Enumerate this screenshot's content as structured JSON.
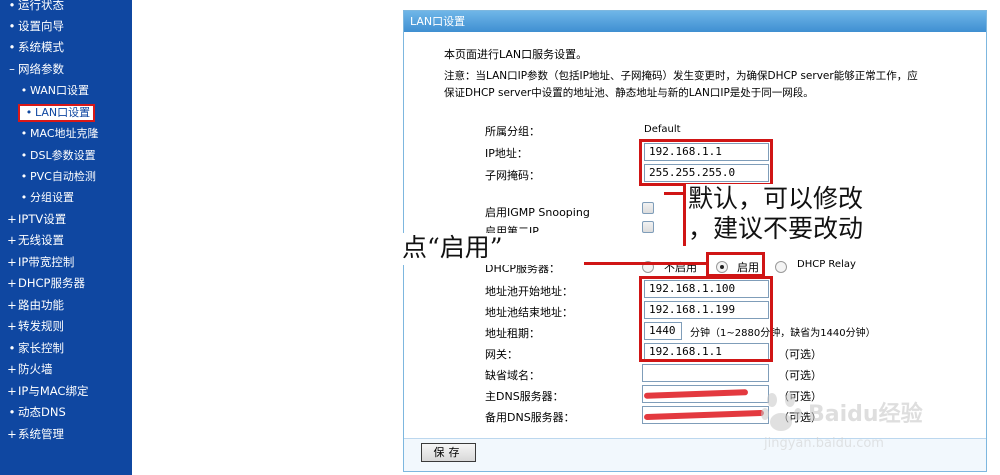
{
  "sidebar": {
    "items": [
      {
        "label": "运行状态",
        "mark": "•"
      },
      {
        "label": "设置向导",
        "mark": "•"
      },
      {
        "label": "系统模式",
        "mark": "•"
      },
      {
        "label": "网络参数",
        "mark": "–"
      },
      {
        "label": "WAN口设置",
        "mark": "•"
      },
      {
        "label": "LAN口设置",
        "mark": "•"
      },
      {
        "label": "MAC地址克隆",
        "mark": "•"
      },
      {
        "label": "DSL参数设置",
        "mark": "•"
      },
      {
        "label": "PVC自动检测",
        "mark": "•"
      },
      {
        "label": "分组设置",
        "mark": "•"
      },
      {
        "label": "IPTV设置",
        "mark": "+"
      },
      {
        "label": "无线设置",
        "mark": "+"
      },
      {
        "label": "IP带宽控制",
        "mark": "+"
      },
      {
        "label": "DHCP服务器",
        "mark": "+"
      },
      {
        "label": "路由功能",
        "mark": "+"
      },
      {
        "label": "转发规则",
        "mark": "+"
      },
      {
        "label": "家长控制",
        "mark": "•"
      },
      {
        "label": "防火墙",
        "mark": "+"
      },
      {
        "label": "IP与MAC绑定",
        "mark": "+"
      },
      {
        "label": "动态DNS",
        "mark": "•"
      },
      {
        "label": "系统管理",
        "mark": "+"
      }
    ]
  },
  "panel": {
    "title": "LAN口设置",
    "intro": "本页面进行LAN口服务设置。",
    "note_line1": "注意：当LAN口IP参数（包括IP地址、子网掩码）发生变更时，为确保DHCP server能够正常工作，应",
    "note_line2": "保证DHCP server中设置的地址池、静态地址与新的LAN口IP是处于同一网段。"
  },
  "form": {
    "group_label": "所属分组：",
    "group_value": "Default",
    "ip_label": "IP地址：",
    "ip_value": "192.168.1.1",
    "mask_label": "子网掩码：",
    "mask_value": "255.255.255.0",
    "igmp_label": "启用IGMP Snooping",
    "second_ip_label": "启用第二IP",
    "dhcp_label": "DHCP服务器：",
    "dhcp_options": {
      "off": "不启用",
      "on": "启用",
      "relay": "DHCP Relay"
    },
    "dhcp_selected": "启用",
    "pool_start_label": "地址池开始地址：",
    "pool_start_value": "192.168.1.100",
    "pool_end_label": "地址池结束地址：",
    "pool_end_value": "192.168.1.199",
    "lease_label": "地址租期：",
    "lease_value": "1440",
    "lease_hint": "分钟（1~2880分钟，缺省为1440分钟）",
    "gateway_label": "网关：",
    "gateway_value": "192.168.1.1",
    "optional": "（可选）",
    "domain_label": "缺省域名：",
    "domain_value": "",
    "dns1_label": "主DNS服务器：",
    "dns2_label": "备用DNS服务器：",
    "save_label": "保存"
  },
  "annotations": {
    "default_note_line1": "默认，可以修改",
    "default_note_line2": "，建议不要改动",
    "click_enable": "点“启用”"
  },
  "watermark": {
    "brand": "Baidu经验",
    "url": "jingyan.baidu.com"
  },
  "colors": {
    "sidebar_bg": "#0f47a1",
    "panel_header": "#4a9ad8",
    "highlight_red": "#d01515"
  }
}
